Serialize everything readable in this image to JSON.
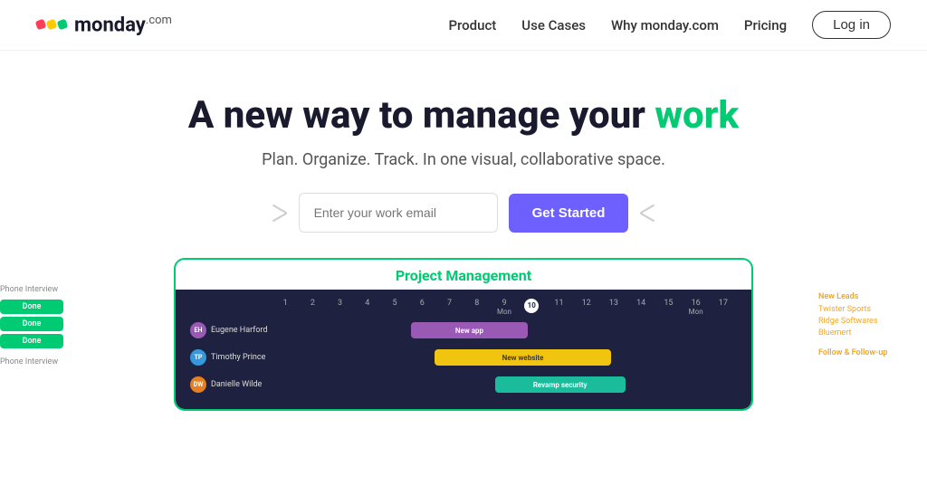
{
  "logo": {
    "text": "monday",
    "com": ".com"
  },
  "nav": {
    "links": [
      {
        "id": "product",
        "label": "Product"
      },
      {
        "id": "use-cases",
        "label": "Use Cases"
      },
      {
        "id": "why-monday",
        "label": "Why monday.com"
      },
      {
        "id": "pricing",
        "label": "Pricing"
      }
    ],
    "login_label": "Log in"
  },
  "hero": {
    "headline_start": "A new way to manage your ",
    "headline_highlight": "work",
    "subheadline": "Plan. Organize. Track. In one visual, collaborative space.",
    "email_placeholder": "Enter your work email",
    "cta_label": "Get Started"
  },
  "preview": {
    "title": "Project Management",
    "days": [
      "1",
      "2",
      "3",
      "4",
      "5",
      "6",
      "7",
      "8",
      "9",
      "Mon",
      "10",
      "11",
      "12",
      "13",
      "14",
      "15",
      "Mon",
      "16",
      "17"
    ],
    "today": "10",
    "rows": [
      {
        "name": "Eugene Harford",
        "avatar_initials": "EH",
        "avatar_color": "#9b59b6",
        "bar_label": "New app",
        "bar_color": "#9b59b6",
        "bar_left": "35%",
        "bar_width": "22%"
      },
      {
        "name": "Timothy Prince",
        "avatar_initials": "TP",
        "avatar_color": "#3498db",
        "bar_label": "New website",
        "bar_color": "#f1c40f",
        "bar_left": "37%",
        "bar_width": "32%"
      },
      {
        "name": "Danielle Wilde",
        "avatar_initials": "DW",
        "avatar_color": "#e67e22",
        "bar_label": "Revamp security",
        "bar_color": "#1abc9c",
        "bar_left": "48%",
        "bar_width": "24%"
      }
    ]
  },
  "side_left": {
    "label": "Phone Interview",
    "done_buttons": [
      "Done",
      "Done",
      "Done"
    ],
    "bottom_label": "Phone Interview"
  },
  "side_right": {
    "section1_label": "New Leads",
    "items1": [
      "Twister Sports",
      "Ridge Softwares",
      "Bluemert"
    ],
    "section2_label": "Follow & Follow-up"
  }
}
